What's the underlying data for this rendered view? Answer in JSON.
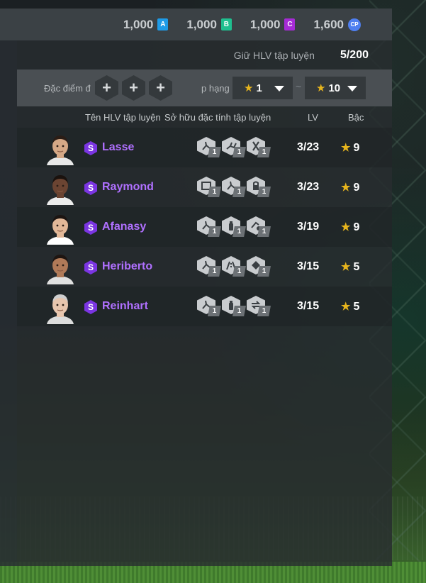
{
  "currencies": [
    {
      "amount": "1,000",
      "badge": "A",
      "color": "#1e9be8",
      "icon": "a-token-icon"
    },
    {
      "amount": "1,000",
      "badge": "B",
      "color": "#1fbf8f",
      "icon": "b-token-icon"
    },
    {
      "amount": "1,000",
      "badge": "C",
      "color": "#a62bd6",
      "icon": "c-token-icon"
    },
    {
      "amount": "1,600",
      "badge": "CP",
      "color": "#4f7ff0",
      "icon": "cp-coin-icon"
    }
  ],
  "hold": {
    "label": "Giữ HLV tập luyện",
    "value": "5/200"
  },
  "filters": {
    "attribute_label": "Đặc điểm đ",
    "add_symbol": "+",
    "rank_label": "p hạng",
    "rank_min": "1",
    "rank_max": "10",
    "separator": "~"
  },
  "columns": {
    "name": "Tên HLV tập luyện",
    "traits": "Sở hữu đặc tính tập luyện",
    "lv": "LV",
    "grade": "Bậc"
  },
  "coaches": [
    {
      "tier": "S",
      "name": "Lasse",
      "lv": "3/23",
      "grade": "9",
      "traits": [
        {
          "icon": "kick-trait-icon",
          "level": "1"
        },
        {
          "icon": "sprint-trait-icon",
          "level": "1"
        },
        {
          "icon": "tools-trait-icon",
          "level": "1"
        }
      ]
    },
    {
      "tier": "S",
      "name": "Raymond",
      "lv": "3/23",
      "grade": "9",
      "traits": [
        {
          "icon": "goal-trait-icon",
          "level": "1"
        },
        {
          "icon": "kick-trait-icon",
          "level": "1"
        },
        {
          "icon": "lock-trait-icon",
          "level": "1"
        }
      ]
    },
    {
      "tier": "S",
      "name": "Afanasy",
      "lv": "3/19",
      "grade": "9",
      "traits": [
        {
          "icon": "kick-trait-icon",
          "level": "1"
        },
        {
          "icon": "bottle-trait-icon",
          "level": "1"
        },
        {
          "icon": "dribble-trait-icon",
          "level": "1"
        }
      ]
    },
    {
      "tier": "S",
      "name": "Heriberto",
      "lv": "3/15",
      "grade": "5",
      "traits": [
        {
          "icon": "kick-trait-icon",
          "level": "1"
        },
        {
          "icon": "road-trait-icon",
          "level": "1"
        },
        {
          "icon": "save-trait-icon",
          "level": "1"
        }
      ]
    },
    {
      "tier": "S",
      "name": "Reinhart",
      "lv": "3/15",
      "grade": "5",
      "traits": [
        {
          "icon": "kick-trait-icon",
          "level": "1"
        },
        {
          "icon": "bottle-trait-icon",
          "level": "1"
        },
        {
          "icon": "swap-trait-icon",
          "level": "1"
        }
      ]
    }
  ],
  "grade_star": "★"
}
